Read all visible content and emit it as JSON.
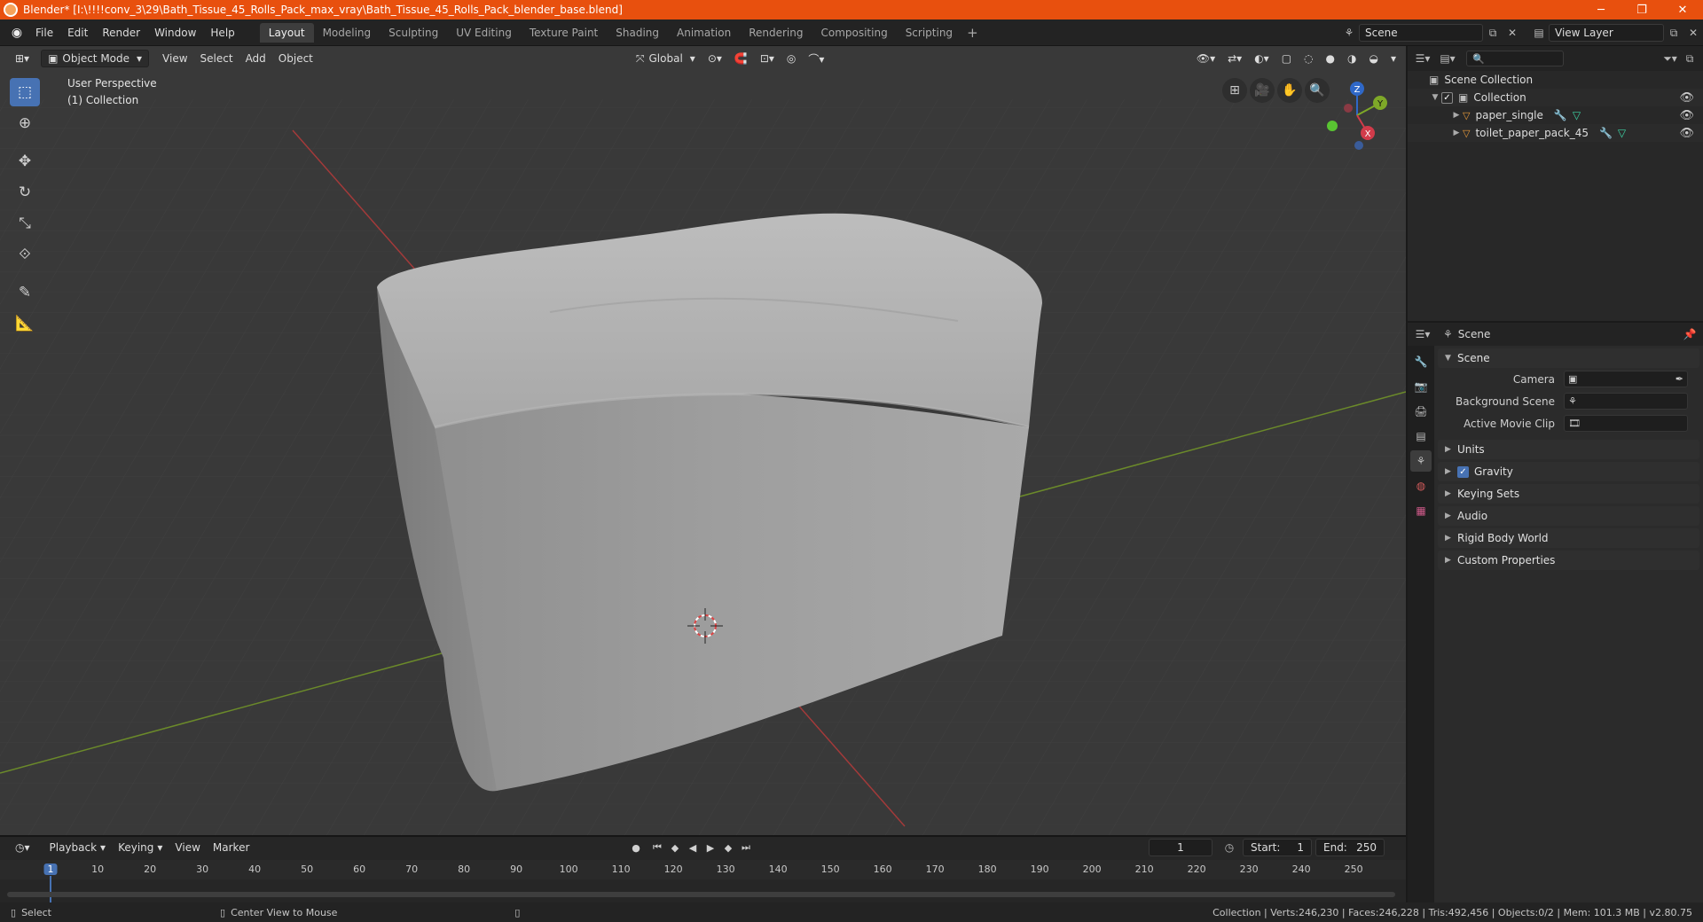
{
  "window": {
    "title": "Blender* [I:\\!!!!conv_3\\29\\Bath_Tissue_45_Rolls_Pack_max_vray\\Bath_Tissue_45_Rolls_Pack_blender_base.blend]",
    "minimize": "─",
    "maximize": "❐",
    "close": "✕"
  },
  "menu": [
    "File",
    "Edit",
    "Render",
    "Window",
    "Help"
  ],
  "workspaces": [
    "Layout",
    "Modeling",
    "Sculpting",
    "UV Editing",
    "Texture Paint",
    "Shading",
    "Animation",
    "Rendering",
    "Compositing",
    "Scripting"
  ],
  "workspace_add": "+",
  "scene_name": "Scene",
  "view_layer": "View Layer",
  "viewport": {
    "mode": "Object Mode",
    "header_menus": [
      "View",
      "Select",
      "Add",
      "Object"
    ],
    "orientation": "Global",
    "perspective": "User Perspective",
    "collection": "(1) Collection",
    "gizmo_axes": {
      "x": "X",
      "y": "Y",
      "z": "Z"
    }
  },
  "outliner": {
    "search_placeholder": "",
    "root": "Scene Collection",
    "collection": "Collection",
    "objects": [
      "paper_single",
      "toilet_paper_pack_45"
    ]
  },
  "properties": {
    "context": "Scene",
    "panel_scene": "Scene",
    "camera_label": "Camera",
    "background_scene_label": "Background Scene",
    "active_movie_clip_label": "Active Movie Clip",
    "subpanels": [
      "Units",
      "Gravity",
      "Keying Sets",
      "Audio",
      "Rigid Body World",
      "Custom Properties"
    ]
  },
  "timeline": {
    "menus": [
      "Playback",
      "Keying",
      "View",
      "Marker"
    ],
    "current_frame": "1",
    "start_label": "Start:",
    "start": "1",
    "end_label": "End:",
    "end": "250",
    "ticks": [
      "1",
      "10",
      "20",
      "30",
      "40",
      "50",
      "60",
      "70",
      "80",
      "90",
      "100",
      "110",
      "120",
      "130",
      "140",
      "150",
      "160",
      "170",
      "180",
      "190",
      "200",
      "210",
      "220",
      "230",
      "240",
      "250"
    ]
  },
  "statusbar": {
    "left_action": "Select",
    "middle_action": "Center View to Mouse",
    "stats": "Collection | Verts:246,230 | Faces:246,228 | Tris:492,456 | Objects:0/2 | Mem: 101.3 MB | v2.80.75"
  }
}
